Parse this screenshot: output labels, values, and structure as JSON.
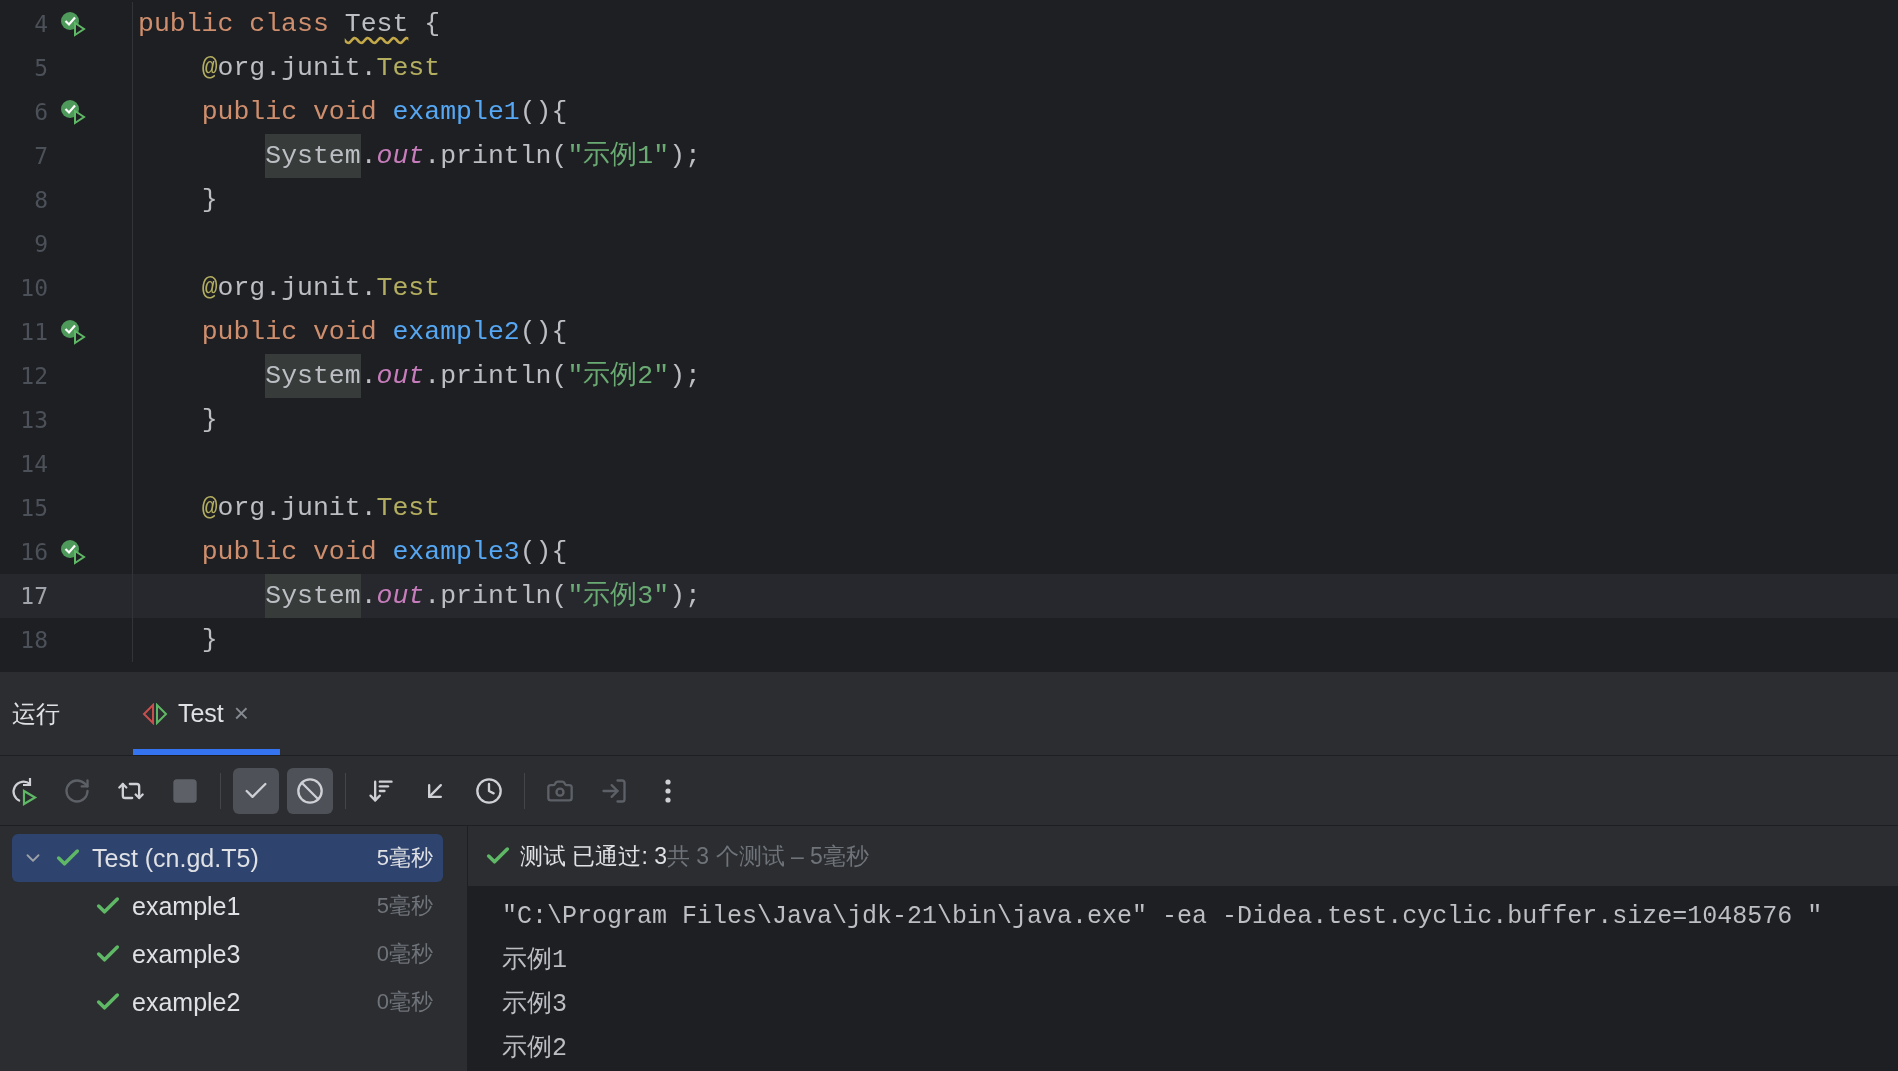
{
  "editor": {
    "lines": [
      {
        "number": "4",
        "run_marker": true,
        "current": false,
        "tokens": [
          {
            "kind": "keyword",
            "text": "public class "
          },
          {
            "kind": "warned",
            "text": "Test"
          },
          {
            "kind": "plain",
            "text": " {"
          }
        ]
      },
      {
        "number": "5",
        "run_marker": false,
        "current": false,
        "tokens": [
          {
            "kind": "annotation",
            "text": "    @"
          },
          {
            "kind": "plain",
            "text": "org.junit."
          },
          {
            "kind": "type",
            "text": "Test"
          }
        ]
      },
      {
        "number": "6",
        "run_marker": true,
        "current": false,
        "tokens": [
          {
            "kind": "keyword",
            "text": "    public void "
          },
          {
            "kind": "method",
            "text": "example1"
          },
          {
            "kind": "plain",
            "text": "(){"
          }
        ]
      },
      {
        "number": "7",
        "run_marker": false,
        "current": false,
        "tokens": [
          {
            "kind": "highlight",
            "text": "        System"
          },
          {
            "kind": "plain",
            "text": "."
          },
          {
            "kind": "field",
            "text": "out"
          },
          {
            "kind": "plain",
            "text": ".println("
          },
          {
            "kind": "string",
            "text": "\"示例1\""
          },
          {
            "kind": "plain",
            "text": ");"
          }
        ]
      },
      {
        "number": "8",
        "run_marker": false,
        "current": false,
        "tokens": [
          {
            "kind": "plain",
            "text": "    }"
          }
        ]
      },
      {
        "number": "9",
        "run_marker": false,
        "current": false
      },
      {
        "number": "10",
        "run_marker": false,
        "current": false,
        "tokens": [
          {
            "kind": "annotation",
            "text": "    @"
          },
          {
            "kind": "plain",
            "text": "org.junit."
          },
          {
            "kind": "type",
            "text": "Test"
          }
        ]
      },
      {
        "number": "11",
        "run_marker": true,
        "current": false,
        "tokens": [
          {
            "kind": "keyword",
            "text": "    public void "
          },
          {
            "kind": "method",
            "text": "example2"
          },
          {
            "kind": "plain",
            "text": "(){"
          }
        ]
      },
      {
        "number": "12",
        "run_marker": false,
        "current": false,
        "tokens": [
          {
            "kind": "highlight",
            "text": "        System"
          },
          {
            "kind": "plain",
            "text": "."
          },
          {
            "kind": "field",
            "text": "out"
          },
          {
            "kind": "plain",
            "text": ".println("
          },
          {
            "kind": "string",
            "text": "\"示例2\""
          },
          {
            "kind": "plain",
            "text": ");"
          }
        ]
      },
      {
        "number": "13",
        "run_marker": false,
        "current": false,
        "tokens": [
          {
            "kind": "plain",
            "text": "    }"
          }
        ]
      },
      {
        "number": "14",
        "run_marker": false,
        "current": false
      },
      {
        "number": "15",
        "run_marker": false,
        "current": false,
        "tokens": [
          {
            "kind": "annotation",
            "text": "    @"
          },
          {
            "kind": "plain",
            "text": "org.junit."
          },
          {
            "kind": "type",
            "text": "Test"
          }
        ]
      },
      {
        "number": "16",
        "run_marker": true,
        "current": false,
        "tokens": [
          {
            "kind": "keyword",
            "text": "    public void "
          },
          {
            "kind": "method",
            "text": "example3"
          },
          {
            "kind": "plain",
            "text": "(){"
          }
        ]
      },
      {
        "number": "17",
        "run_marker": false,
        "current": true,
        "tokens": [
          {
            "kind": "highlight",
            "text": "        System"
          },
          {
            "kind": "plain",
            "text": "."
          },
          {
            "kind": "field",
            "text": "out"
          },
          {
            "kind": "plain",
            "text": ".println("
          },
          {
            "kind": "string",
            "text": "\"示例3\""
          },
          {
            "kind": "plain",
            "text": ");"
          }
        ]
      },
      {
        "number": "18",
        "run_marker": false,
        "current": false,
        "tokens": [
          {
            "kind": "plain",
            "text": "    }"
          }
        ]
      }
    ]
  },
  "run_panel": {
    "title": "运行",
    "tabs": [
      {
        "label": "Test",
        "close": "×",
        "selected": true
      }
    ],
    "toolbar": [
      {
        "buttons": [
          {
            "kind": "rerun",
            "selected": false,
            "disabled": false
          },
          {
            "kind": "rerun-failed",
            "selected": false,
            "disabled": true
          },
          {
            "kind": "auto-test",
            "selected": false,
            "disabled": false
          },
          {
            "kind": "stop",
            "selected": false,
            "disabled": true
          }
        ]
      },
      {
        "buttons": [
          {
            "kind": "show-passed",
            "selected": true,
            "disabled": false
          },
          {
            "kind": "show-ignored",
            "selected": true,
            "disabled": false
          }
        ]
      },
      {
        "buttons": [
          {
            "kind": "sort",
            "selected": false,
            "disabled": false
          },
          {
            "kind": "collapse",
            "selected": false,
            "disabled": false
          },
          {
            "kind": "history",
            "selected": false,
            "disabled": false
          }
        ]
      },
      {
        "buttons": [
          {
            "kind": "screenshot",
            "selected": false,
            "disabled": true
          },
          {
            "kind": "export",
            "selected": false,
            "disabled": true
          },
          {
            "kind": "more",
            "selected": false,
            "disabled": false
          }
        ]
      }
    ],
    "tree": [
      {
        "name": "Test (cn.gd.T5)",
        "duration": "5毫秒",
        "passed": true,
        "selected": true,
        "expanded": true,
        "children": [
          {
            "name": "example1",
            "duration": "5毫秒",
            "passed": true,
            "selected": false
          },
          {
            "name": "example3",
            "duration": "0毫秒",
            "passed": true,
            "selected": false
          },
          {
            "name": "example2",
            "duration": "0毫秒",
            "passed": true,
            "selected": false
          }
        ]
      }
    ],
    "status": {
      "passed": true,
      "result": "测试 已通过: 3",
      "summary": "共 3 个测试 – 5毫秒"
    },
    "console": [
      "\"C:\\Program Files\\Java\\jdk-21\\bin\\java.exe\" -ea -Didea.test.cyclic.buffer.size=1048576 \"",
      "示例1",
      "示例3",
      "示例2"
    ]
  }
}
